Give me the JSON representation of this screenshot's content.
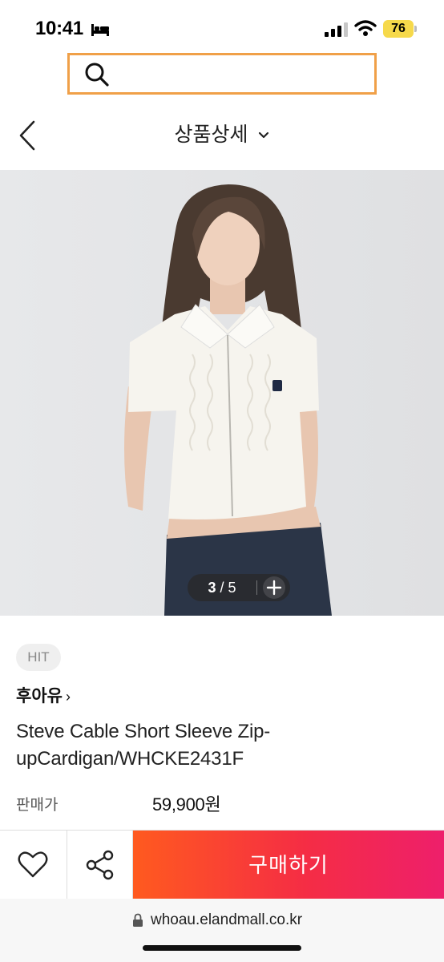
{
  "status_bar": {
    "time": "10:41",
    "battery": "76",
    "icons": [
      "bed-icon",
      "signal-icon",
      "wifi-icon",
      "battery-icon"
    ]
  },
  "search": {
    "placeholder": "",
    "icon": "search-icon"
  },
  "header": {
    "title": "상품상세",
    "back_icon": "chevron-left-icon",
    "title_icon": "chevron-down-icon"
  },
  "gallery": {
    "current": "3",
    "separator": "/",
    "total": "5",
    "zoom_icon": "plus-icon"
  },
  "product": {
    "badge": "HIT",
    "brand": "후아유",
    "brand_arrow": "›",
    "name": "Steve Cable Short Sleeve Zip-upCardigan/WHCKE2431F",
    "price_label": "판매가",
    "price": "59,900원"
  },
  "actions": {
    "wish_icon": "heart-icon",
    "share_icon": "share-icon",
    "buy_label": "구매하기",
    "buy_gradient": [
      "#ff5a1f",
      "#f52d44",
      "#ee1f6b"
    ]
  },
  "browser": {
    "url": "whoau.elandmall.co.kr",
    "lock_icon": "lock-icon"
  },
  "colors": {
    "search_border": "#f0a048",
    "battery": "#f6d94b"
  }
}
